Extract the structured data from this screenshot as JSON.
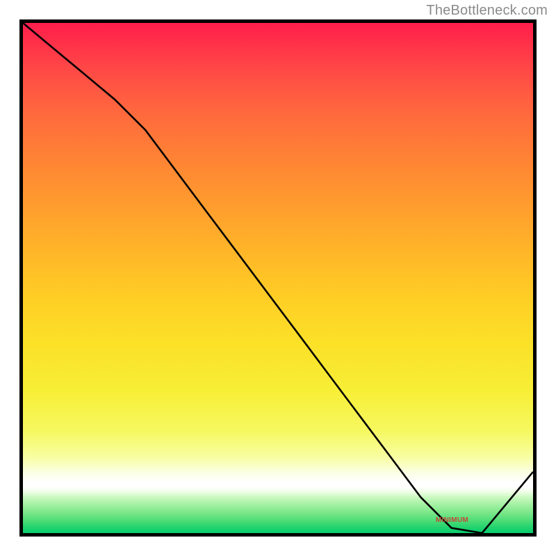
{
  "watermark": "TheBottleneck.com",
  "chart_data": {
    "type": "line",
    "title": "",
    "xlabel": "",
    "ylabel": "",
    "xlim": [
      0,
      100
    ],
    "ylim": [
      0,
      100
    ],
    "x": [
      0,
      6,
      12,
      18,
      24,
      30,
      36,
      42,
      48,
      54,
      60,
      66,
      72,
      78,
      84,
      90,
      100
    ],
    "values": [
      100,
      95,
      90,
      85,
      79,
      71,
      63,
      55,
      47,
      39,
      31,
      23,
      15,
      7,
      1,
      0,
      12
    ],
    "minimum_region_x": [
      80,
      90
    ],
    "minimum_label": "MINIMUM",
    "gradient_stops": [
      {
        "pos": 0.0,
        "color": "#ff1d4b"
      },
      {
        "pos": 0.5,
        "color": "#ffce25"
      },
      {
        "pos": 0.9,
        "color": "#ffffff"
      },
      {
        "pos": 1.0,
        "color": "#06cf6e"
      }
    ]
  }
}
